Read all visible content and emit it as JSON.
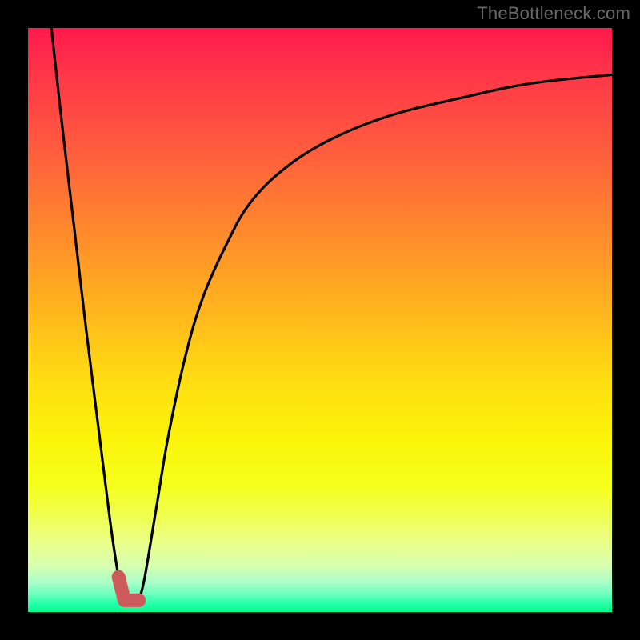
{
  "watermark": "TheBottleneck.com",
  "chart_data": {
    "type": "line",
    "title": "",
    "xlabel": "",
    "ylabel": "",
    "xlim": [
      0,
      100
    ],
    "ylim": [
      0,
      100
    ],
    "grid": false,
    "legend": false,
    "background": "red-yellow-green vertical gradient (bottleneck severity)",
    "series": [
      {
        "name": "left-branch",
        "x": [
          4,
          6,
          8,
          10,
          12,
          14,
          15.5,
          16.5
        ],
        "values": [
          100,
          82,
          65,
          48,
          32,
          16,
          6,
          2
        ]
      },
      {
        "name": "right-branch",
        "x": [
          19,
          20,
          22,
          24,
          27,
          30,
          34,
          38,
          44,
          52,
          62,
          74,
          86,
          100
        ],
        "values": [
          2,
          6,
          18,
          30,
          44,
          54,
          63,
          70,
          76,
          81,
          85,
          88,
          90.5,
          92
        ]
      },
      {
        "name": "optimal-marker",
        "color": "#cc5a5a",
        "x": [
          15.5,
          16.5,
          19
        ],
        "values": [
          6,
          2,
          2
        ]
      }
    ],
    "annotations": []
  }
}
